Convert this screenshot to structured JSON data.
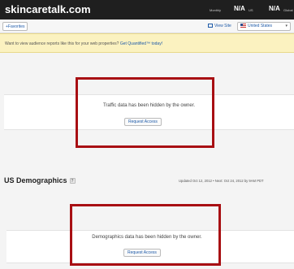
{
  "header": {
    "site": "skincaretalk.com",
    "monthly_label": "Monthly",
    "monthly_value": "N/A",
    "us_label": "US",
    "global_value": "N/A",
    "global_label": "Global"
  },
  "toolbar": {
    "favorites_label": "+Favorites",
    "view_site_label": "View Site",
    "country_selected": "United States"
  },
  "banner": {
    "text": "Want to view audience reports like this for your web properties? ",
    "link": "Get Quantified™ today!"
  },
  "traffic": {
    "message": "Traffic data has been hidden by the owner.",
    "button": "Request Access"
  },
  "demographics": {
    "title": "US Demographics",
    "help_glyph": "?",
    "updated": "Updated Oct 12, 2012 • Next: Oct 24, 2012 by 9AM PDT",
    "message": "Demographics data has been hidden by the owner.",
    "button": "Request Access"
  },
  "colors": {
    "topbar": "#1f1f1f",
    "banner": "#fbf2c0",
    "highlight_box": "#a80f13",
    "link": "#1e5aa8"
  }
}
